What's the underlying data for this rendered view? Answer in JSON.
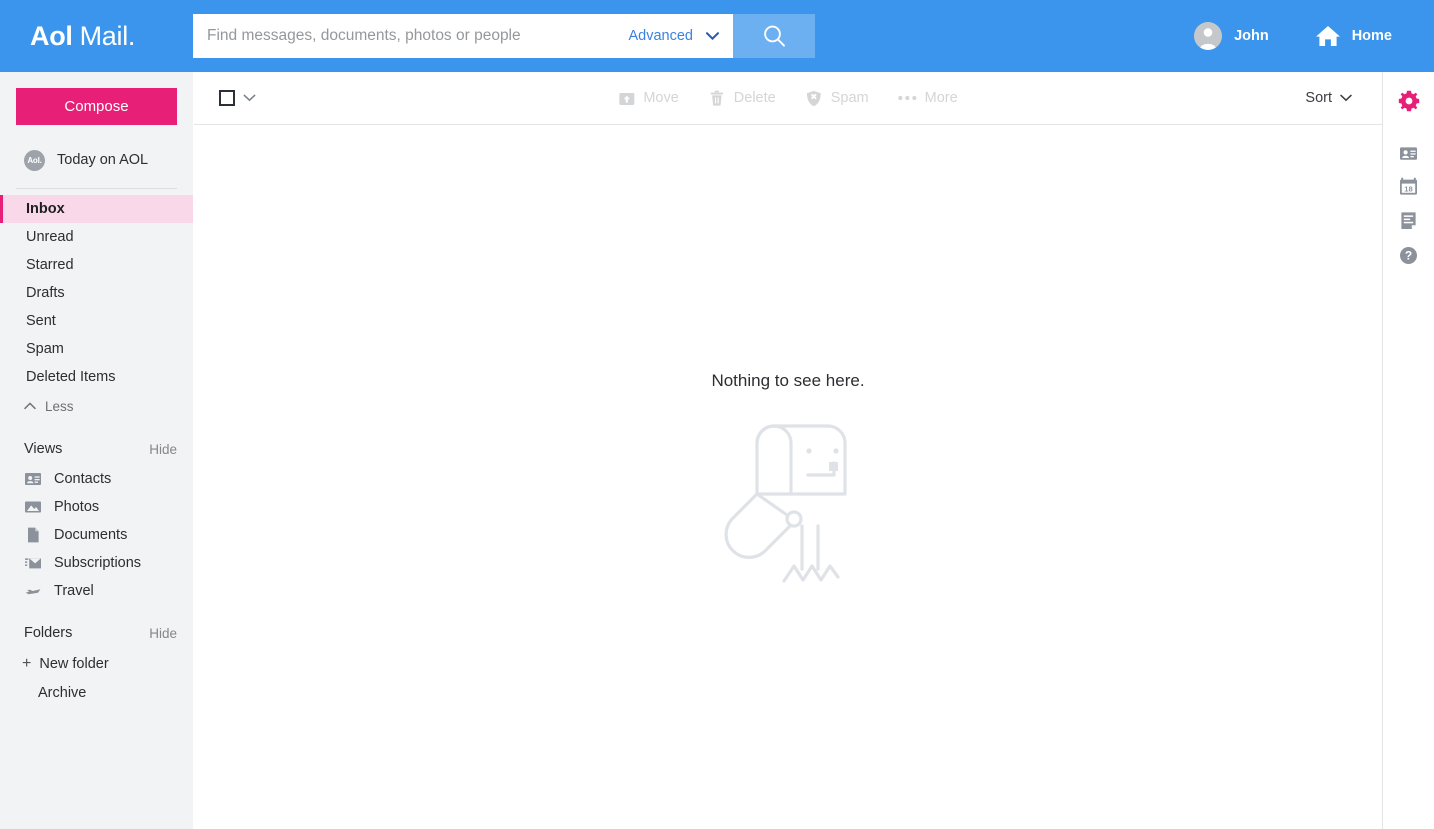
{
  "brand": {
    "name_bold": "Aol",
    "name_rest": "Mail.",
    "accent_pink": "#e81f76",
    "header_blue": "#3b95ec"
  },
  "header": {
    "search": {
      "placeholder": "Find messages, documents, photos or people",
      "value": ""
    },
    "advanced_label": "Advanced",
    "search_icon": "search-icon",
    "user": {
      "name": "John",
      "avatar_icon": "person-avatar-icon"
    },
    "home": {
      "label": "Home",
      "icon": "home-icon"
    }
  },
  "sidebar": {
    "compose_label": "Compose",
    "today": {
      "label": "Today on AOL",
      "badge": "Aol."
    },
    "folders": [
      {
        "label": "Inbox",
        "active": true
      },
      {
        "label": "Unread",
        "active": false
      },
      {
        "label": "Starred",
        "active": false
      },
      {
        "label": "Drafts",
        "active": false
      },
      {
        "label": "Sent",
        "active": false
      },
      {
        "label": "Spam",
        "active": false
      },
      {
        "label": "Deleted Items",
        "active": false
      }
    ],
    "less_label": "Less",
    "views_section": {
      "title": "Views",
      "toggle_label": "Hide",
      "items": [
        {
          "label": "Contacts",
          "icon": "contact-card-icon"
        },
        {
          "label": "Photos",
          "icon": "photo-icon"
        },
        {
          "label": "Documents",
          "icon": "document-icon"
        },
        {
          "label": "Subscriptions",
          "icon": "subscriptions-envelope-icon"
        },
        {
          "label": "Travel",
          "icon": "airplane-icon"
        }
      ]
    },
    "folders_section": {
      "title": "Folders",
      "toggle_label": "Hide",
      "new_folder_label": "New folder",
      "items": [
        {
          "label": "Archive"
        }
      ]
    }
  },
  "toolbar": {
    "select_all_checkbox": "unchecked",
    "select_all_caret": "chevron-down-icon",
    "actions": [
      {
        "label": "Move",
        "icon": "move-to-folder-icon",
        "disabled": true
      },
      {
        "label": "Delete",
        "icon": "trash-icon",
        "disabled": true
      },
      {
        "label": "Spam",
        "icon": "spam-shield-icon",
        "disabled": true
      },
      {
        "label": "More",
        "icon": "ellipsis-icon",
        "disabled": true
      }
    ],
    "sort_label": "Sort",
    "sort_caret": "chevron-down-icon"
  },
  "main": {
    "empty_state": {
      "message": "Nothing to see here.",
      "illustration": "broken-mailbox-illustration"
    }
  },
  "right_rail": {
    "items": [
      {
        "name": "settings-gear-icon",
        "label": "",
        "color": "#e81f76"
      },
      {
        "name": "contacts-icon",
        "label": "",
        "color": "#8c929b"
      },
      {
        "name": "calendar-icon",
        "label": "18",
        "color": "#8c929b"
      },
      {
        "name": "notepad-icon",
        "label": "",
        "color": "#8c929b"
      },
      {
        "name": "help-icon",
        "label": "",
        "color": "#8c929b"
      }
    ],
    "calendar_day": "18"
  }
}
